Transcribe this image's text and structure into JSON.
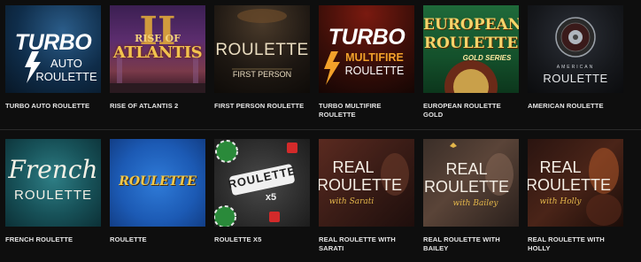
{
  "games_row_1": [
    {
      "title": "TURBO AUTO ROULETTE",
      "art": {
        "line1": "TURBO",
        "line2": "AUTO",
        "line3": "ROULETTE"
      },
      "icon": "lightning-icon"
    },
    {
      "title": "RISE OF ATLANTIS 2",
      "art": {
        "line1": "RISE OF",
        "line2": "ATLANTIS",
        "line3": "II"
      }
    },
    {
      "title": "FIRST PERSON ROULETTE",
      "art": {
        "line1": "ROULETTE",
        "line2": "FIRST PERSON"
      }
    },
    {
      "title": "TURBO MULTIFIRE ROULETTE",
      "art": {
        "line1": "TURBO",
        "line2": "MULTIFIRE",
        "line3": "ROULETTE"
      },
      "icon": "lightning-icon"
    },
    {
      "title": "EUROPEAN ROULETTE GOLD",
      "art": {
        "line1": "EUROPEAN",
        "line2": "ROULETTE",
        "line3": "GOLD SERIES"
      }
    },
    {
      "title": "AMERICAN ROULETTE",
      "art": {
        "line1": "AMERICAN",
        "line2": "ROULETTE"
      },
      "icon": "roulette-wheel-icon"
    }
  ],
  "games_row_2": [
    {
      "title": "FRENCH ROULETTE",
      "art": {
        "line1": "French",
        "line2": "ROULETTE"
      }
    },
    {
      "title": "ROULETTE",
      "art": {
        "line1": "ROULETTE"
      }
    },
    {
      "title": "ROULETTE X5",
      "art": {
        "line1": "ROULETTE",
        "line2": "x5"
      },
      "icon": "casino-chip-icon"
    },
    {
      "title": "REAL ROULETTE WITH SARATI",
      "art": {
        "line1": "REAL",
        "line2": "ROULETTE",
        "line3": "with Sarati"
      }
    },
    {
      "title": "REAL ROULETTE WITH BAILEY",
      "art": {
        "line1": "REAL",
        "line2": "ROULETTE",
        "line3": "with Bailey"
      }
    },
    {
      "title": "REAL ROULETTE WITH HOLLY",
      "art": {
        "line1": "REAL",
        "line2": "ROULETTE",
        "line3": "with Holly"
      }
    }
  ],
  "colors": {
    "background": "#0e0e0e",
    "caption": "#e6e6e6",
    "divider": "#2b2b2b",
    "gold": "#e3b64a"
  }
}
